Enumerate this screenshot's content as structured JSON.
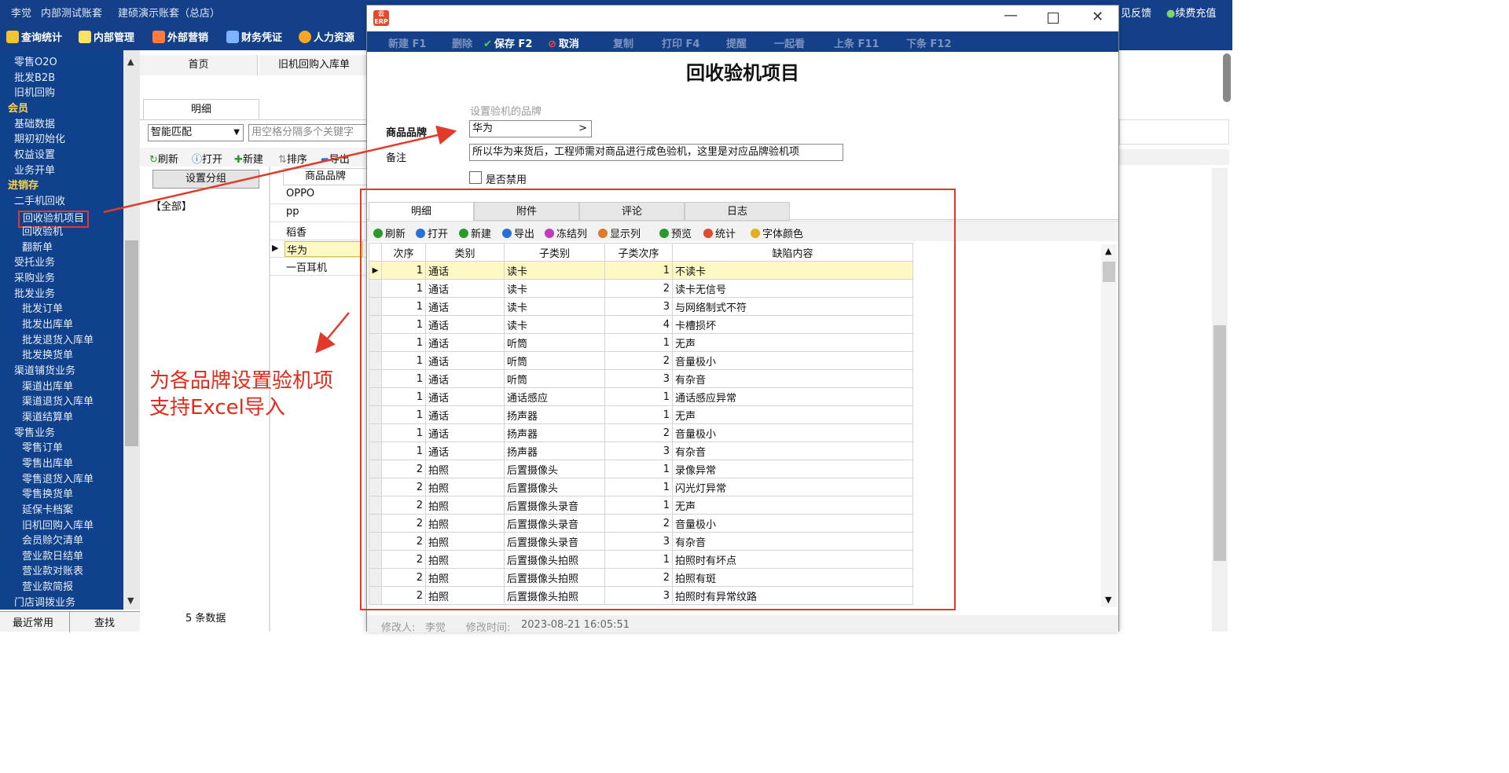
{
  "titlebar": {
    "user": "李觉",
    "account": "内部测试账套",
    "company": "建硕演示账套（总店）",
    "feedback": "见反馈",
    "recharge": "续费充值"
  },
  "menu": [
    "查询统计",
    "内部管理",
    "外部营销",
    "财务凭证",
    "人力资源"
  ],
  "sidebar": {
    "items": [
      {
        "label": "零售O2O",
        "type": "item"
      },
      {
        "label": "批发B2B",
        "type": "item"
      },
      {
        "label": "旧机回购",
        "type": "item"
      },
      {
        "label": "会员",
        "type": "header"
      },
      {
        "label": "基础数据",
        "type": "item"
      },
      {
        "label": "期初初始化",
        "type": "item"
      },
      {
        "label": "权益设置",
        "type": "item"
      },
      {
        "label": "业务开单",
        "type": "item"
      },
      {
        "label": "进销存",
        "type": "header"
      },
      {
        "label": "二手机回收",
        "type": "item"
      },
      {
        "label": "回收验机项目",
        "type": "sub",
        "selected": true
      },
      {
        "label": "回收验机",
        "type": "sub"
      },
      {
        "label": "翻新单",
        "type": "sub"
      },
      {
        "label": "受托业务",
        "type": "item"
      },
      {
        "label": "采购业务",
        "type": "item"
      },
      {
        "label": "批发业务",
        "type": "item"
      },
      {
        "label": "批发订单",
        "type": "sub"
      },
      {
        "label": "批发出库单",
        "type": "sub"
      },
      {
        "label": "批发退货入库单",
        "type": "sub"
      },
      {
        "label": "批发换货单",
        "type": "sub"
      },
      {
        "label": "渠道铺货业务",
        "type": "item"
      },
      {
        "label": "渠道出库单",
        "type": "sub"
      },
      {
        "label": "渠道退货入库单",
        "type": "sub"
      },
      {
        "label": "渠道结算单",
        "type": "sub"
      },
      {
        "label": "零售业务",
        "type": "item"
      },
      {
        "label": "零售订单",
        "type": "sub"
      },
      {
        "label": "零售出库单",
        "type": "sub"
      },
      {
        "label": "零售退货入库单",
        "type": "sub"
      },
      {
        "label": "零售换货单",
        "type": "sub"
      },
      {
        "label": "延保卡档案",
        "type": "sub"
      },
      {
        "label": "旧机回购入库单",
        "type": "sub"
      },
      {
        "label": "会员赊欠清单",
        "type": "sub"
      },
      {
        "label": "营业款日结单",
        "type": "sub"
      },
      {
        "label": "营业款对账表",
        "type": "sub"
      },
      {
        "label": "营业款简报",
        "type": "sub"
      },
      {
        "label": "门店调拨业务",
        "type": "item"
      }
    ],
    "bottom_tabs": [
      "最近常用",
      "查找"
    ]
  },
  "behind": {
    "tabs": [
      "首页",
      "旧机回购入库单"
    ],
    "subtab": "明细",
    "match_mode": "智能匹配",
    "search_placeholder": "用空格分隔多个关键字",
    "tools": [
      "刷新",
      "打开",
      "新建",
      "排序",
      "导出"
    ],
    "group_button": "设置分组",
    "group_all": "【全部】",
    "brand_header": "商品品牌",
    "brands": [
      "OPPO",
      "pp",
      "稻香",
      "华为",
      "一百耳机"
    ],
    "count": "5 条数据"
  },
  "window": {
    "toolbar": [
      {
        "label": "新建 F1",
        "on": false
      },
      {
        "label": "删除",
        "on": false
      },
      {
        "label": "保存 F2",
        "on": true
      },
      {
        "label": "取消",
        "on": true
      },
      {
        "label": "复制",
        "on": false
      },
      {
        "label": "打印 F4",
        "on": false
      },
      {
        "label": "提醒",
        "on": false
      },
      {
        "label": "一起看",
        "on": false
      },
      {
        "label": "上条 F11",
        "on": false
      },
      {
        "label": "下条 F12",
        "on": false
      }
    ],
    "title": "回收验机项目",
    "hint": "设置验机的品牌",
    "brand_label": "商品品牌",
    "brand_value": "华为",
    "brand_btn": ">",
    "note_label": "备注",
    "note_value": "所以华为来货后，工程师需对商品进行成色验机，这里是对应品牌验机项",
    "disabled_label": "是否禁用",
    "tabs": [
      "明细",
      "附件",
      "评论",
      "日志"
    ],
    "grid_tools": [
      "刷新",
      "打开",
      "新建",
      "导出",
      "冻结列",
      "显示列",
      "预览",
      "统计",
      "字体颜色"
    ],
    "columns": [
      "次序",
      "类别",
      "子类别",
      "子类次序",
      "缺陷内容"
    ],
    "rows": [
      [
        "1",
        "通话",
        "读卡",
        "1",
        "不读卡"
      ],
      [
        "1",
        "通话",
        "读卡",
        "2",
        "读卡无信号"
      ],
      [
        "1",
        "通话",
        "读卡",
        "3",
        "与网络制式不符"
      ],
      [
        "1",
        "通话",
        "读卡",
        "4",
        "卡槽损坏"
      ],
      [
        "1",
        "通话",
        "听筒",
        "1",
        "无声"
      ],
      [
        "1",
        "通话",
        "听筒",
        "2",
        "音量极小"
      ],
      [
        "1",
        "通话",
        "听筒",
        "3",
        "有杂音"
      ],
      [
        "1",
        "通话",
        "通话感应",
        "1",
        "通话感应异常"
      ],
      [
        "1",
        "通话",
        "扬声器",
        "1",
        "无声"
      ],
      [
        "1",
        "通话",
        "扬声器",
        "2",
        "音量极小"
      ],
      [
        "1",
        "通话",
        "扬声器",
        "3",
        "有杂音"
      ],
      [
        "2",
        "拍照",
        "后置摄像头",
        "1",
        "录像异常"
      ],
      [
        "2",
        "拍照",
        "后置摄像头",
        "1",
        "闪光灯异常"
      ],
      [
        "2",
        "拍照",
        "后置摄像头录音",
        "1",
        "无声"
      ],
      [
        "2",
        "拍照",
        "后置摄像头录音",
        "2",
        "音量极小"
      ],
      [
        "2",
        "拍照",
        "后置摄像头录音",
        "3",
        "有杂音"
      ],
      [
        "2",
        "拍照",
        "后置摄像头拍照",
        "1",
        "拍照时有坏点"
      ],
      [
        "2",
        "拍照",
        "后置摄像头拍照",
        "2",
        "拍照有斑"
      ],
      [
        "2",
        "拍照",
        "后置摄像头拍照",
        "3",
        "拍照时有异常纹路"
      ]
    ],
    "footer_modifier_label": "修改人:",
    "footer_modifier": "李觉",
    "footer_time_label": "修改时间:",
    "footer_time": "2023-08-21 16:05:51"
  },
  "annotation": [
    "为各品牌设置验机项",
    "支持Excel导入"
  ],
  "colors": {
    "nav_bg": "#14408a",
    "header_yellow": "#ffd24a",
    "annot_red": "#e23a2a",
    "row_highlight": "#fdf8c4"
  }
}
